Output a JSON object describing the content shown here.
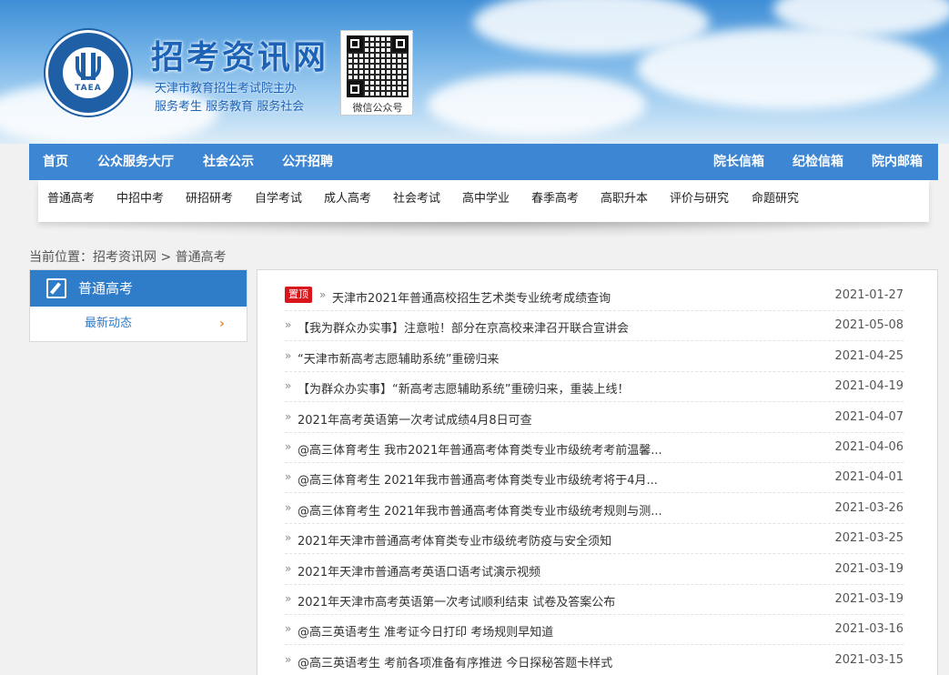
{
  "header": {
    "site_title": "招考资讯网",
    "subtitle_1": "天津市教育招生考试院主办",
    "subtitle_2": "服务考生 服务教育 服务社会",
    "logo_text": "TAEA",
    "qr_label": "微信公众号"
  },
  "main_nav": {
    "left": [
      "首页",
      "公众服务大厅",
      "社会公示",
      "公开招聘"
    ],
    "right": [
      "院长信箱",
      "纪检信箱",
      "院内邮箱"
    ]
  },
  "sub_nav": [
    "普通高考",
    "中招中考",
    "研招研考",
    "自学考试",
    "成人高考",
    "社会考试",
    "高中学业",
    "春季高考",
    "高职升本",
    "评价与研究",
    "命题研究"
  ],
  "breadcrumb": {
    "label": "当前位置：",
    "home": "招考资讯网",
    "sep": ">",
    "current": "普通高考"
  },
  "side": {
    "title": "普通高考",
    "item": "最新动态",
    "arrow": "›"
  },
  "news": {
    "bullet": "»",
    "top_tag": "置顶",
    "items": [
      {
        "title": "天津市2021年普通高校招生艺术类专业统考成绩查询",
        "date": "2021-01-27",
        "pinned": true
      },
      {
        "title": "【我为群众办实事】注意啦！部分在京高校来津召开联合宣讲会",
        "date": "2021-05-08"
      },
      {
        "title": "“天津市新高考志愿辅助系统”重磅归来",
        "date": "2021-04-25"
      },
      {
        "title": "【为群众办实事】“新高考志愿辅助系统”重磅归来，重装上线！",
        "date": "2021-04-19"
      },
      {
        "title": "2021年高考英语第一次考试成绩4月8日可查",
        "date": "2021-04-07"
      },
      {
        "title": "@高三体育考生 我市2021年普通高考体育类专业市级统考考前温馨...",
        "date": "2021-04-06"
      },
      {
        "title": "@高三体育考生 2021年我市普通高考体育类专业市级统考将于4月...",
        "date": "2021-04-01"
      },
      {
        "title": "@高三体育考生 2021年我市普通高考体育类专业市级统考规则与测...",
        "date": "2021-03-26"
      },
      {
        "title": "2021年天津市普通高考体育类专业市级统考防疫与安全须知",
        "date": "2021-03-25"
      },
      {
        "title": "2021年天津市普通高考英语口语考试演示视频",
        "date": "2021-03-19"
      },
      {
        "title": "2021年天津市高考英语第一次考试顺利结束 试卷及答案公布",
        "date": "2021-03-19"
      },
      {
        "title": "@高三英语考生 准考证今日打印 考场规则早知道",
        "date": "2021-03-16"
      },
      {
        "title": "@高三英语考生 考前各项准备有序推进 今日探秘答题卡样式",
        "date": "2021-03-15"
      }
    ]
  }
}
